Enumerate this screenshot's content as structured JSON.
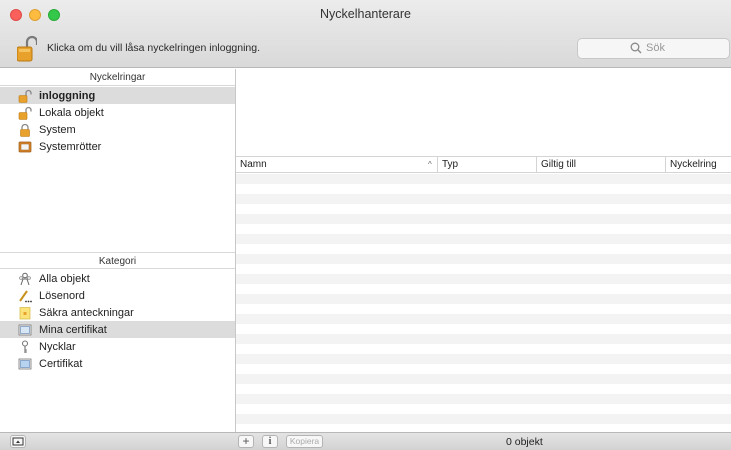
{
  "window": {
    "title": "Nyckelhanterare"
  },
  "toolbar": {
    "lock_message": "Klicka om du vill låsa nyckelringen inloggning.",
    "search_placeholder": "Sök"
  },
  "sidebar": {
    "keychains_header": "Nyckelringar",
    "keychains": [
      {
        "label": "inloggning",
        "icon": "unlocked-padlock-icon",
        "selected": true
      },
      {
        "label": "Lokala objekt",
        "icon": "unlocked-padlock-icon",
        "selected": false
      },
      {
        "label": "System",
        "icon": "locked-padlock-icon",
        "selected": false
      },
      {
        "label": "Systemrötter",
        "icon": "cabinet-icon",
        "selected": false
      }
    ],
    "category_header": "Kategori",
    "categories": [
      {
        "label": "Alla objekt",
        "icon": "people-icon",
        "selected": false
      },
      {
        "label": "Lösenord",
        "icon": "pencil-dots-icon",
        "selected": false
      },
      {
        "label": "Säkra anteckningar",
        "icon": "note-icon",
        "selected": false
      },
      {
        "label": "Mina certifikat",
        "icon": "certificate-icon",
        "selected": true
      },
      {
        "label": "Nycklar",
        "icon": "key-icon",
        "selected": false
      },
      {
        "label": "Certifikat",
        "icon": "certificate-icon",
        "selected": false
      }
    ]
  },
  "table": {
    "columns": [
      "Namn",
      "Typ",
      "Giltig till",
      "Nyckelring"
    ],
    "sort_indicator": "^"
  },
  "bottom": {
    "add_label": "+",
    "info_label": "i",
    "copy_label": "Kopiera",
    "status": "0 objekt"
  },
  "colors": {
    "selection": "#dcdcdc",
    "close": "#fc605c",
    "minimize": "#fdbc40",
    "zoom": "#34c84a"
  }
}
